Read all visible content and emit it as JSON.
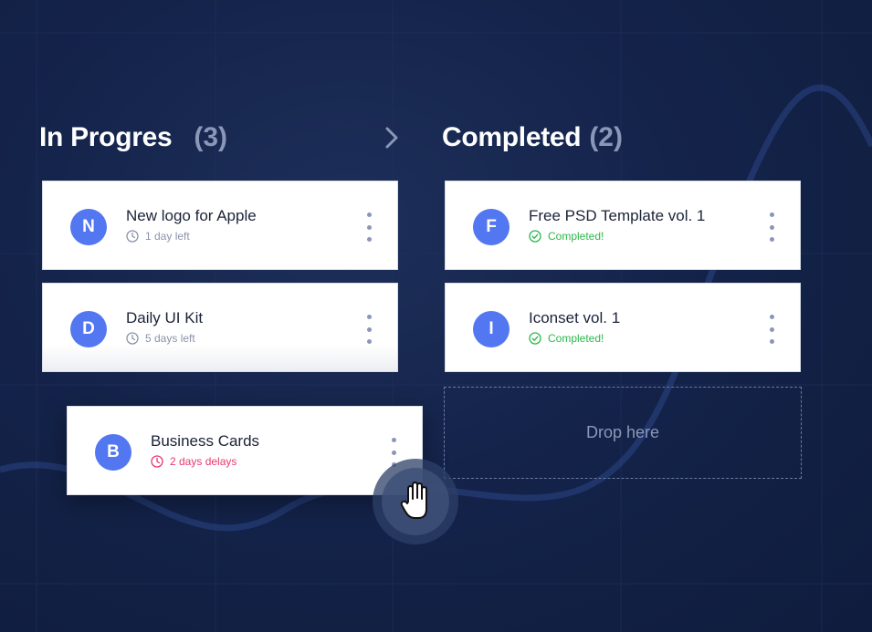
{
  "columns": [
    {
      "title": "In Progres",
      "count": "(3)"
    },
    {
      "title": "Completed",
      "count": "(2)"
    }
  ],
  "in_progress_cards": [
    {
      "initial": "N",
      "title": "New logo for Apple",
      "meta": "1 day left"
    },
    {
      "initial": "D",
      "title": "Daily UI Kit",
      "meta": "5 days left"
    }
  ],
  "completed_cards": [
    {
      "initial": "F",
      "title": "Free PSD Template vol. 1",
      "meta": "Completed!"
    },
    {
      "initial": "I",
      "title": "Iconset vol. 1",
      "meta": "Completed!"
    }
  ],
  "dragged_card": {
    "initial": "B",
    "title": "Business Cards",
    "meta": "2 days delays"
  },
  "drop_zone": {
    "label": "Drop here"
  },
  "colors": {
    "background": "#14234a",
    "avatar": "#5277f0",
    "completed": "#2bb84a",
    "delayed": "#e8386c",
    "muted": "#8a97b8"
  },
  "icons": {
    "next_column": "chevron-right-icon",
    "time": "clock-icon",
    "done": "check-circle-icon",
    "menu": "more-vertical-icon",
    "cursor": "grab-hand-icon"
  }
}
